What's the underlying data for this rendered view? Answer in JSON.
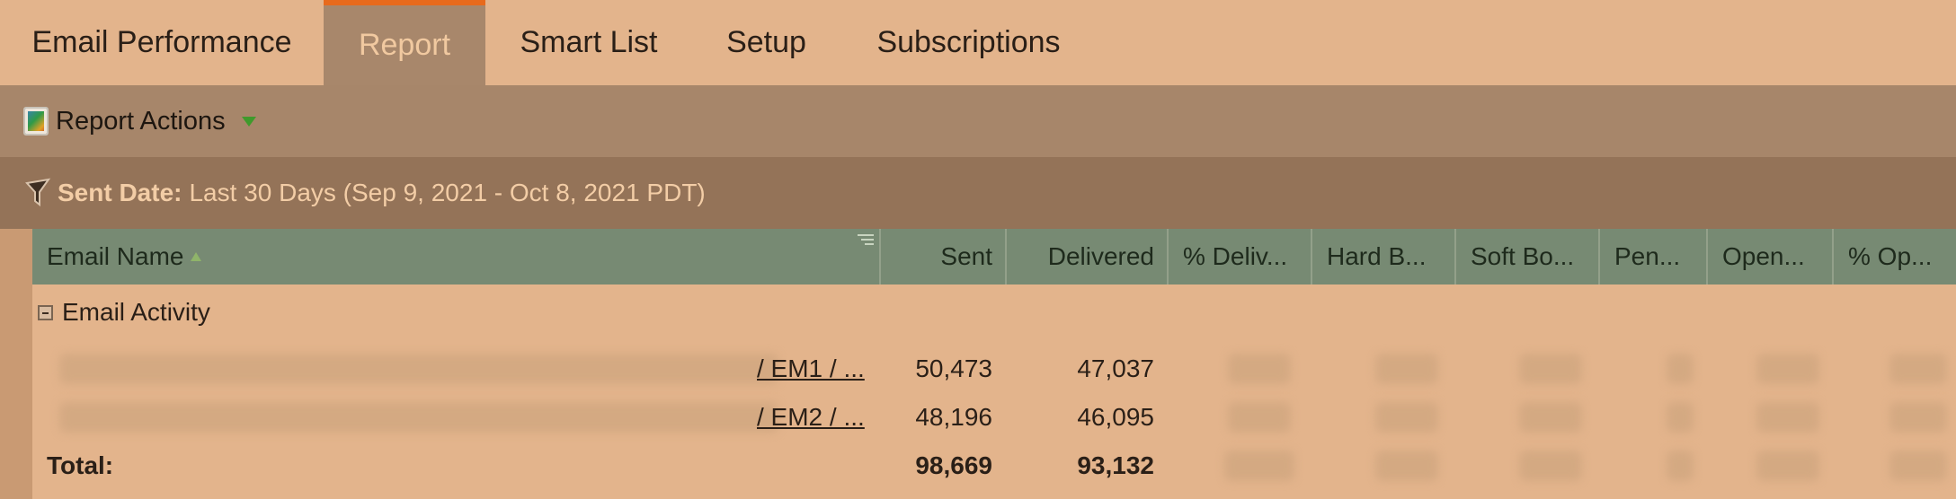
{
  "tabs": [
    {
      "label": "Email Performance",
      "active": false
    },
    {
      "label": "Report",
      "active": true
    },
    {
      "label": "Smart List",
      "active": false
    },
    {
      "label": "Setup",
      "active": false
    },
    {
      "label": "Subscriptions",
      "active": false
    }
  ],
  "actions": {
    "label": "Report Actions",
    "icon": "report-icon",
    "caret": "dropdown-caret-icon"
  },
  "filter": {
    "key": "Sent Date:",
    "value": "Last 30 Days (Sep 9, 2021 - Oct 8, 2021 PDT)",
    "icon": "funnel-icon"
  },
  "columns": [
    "Email Name",
    "Sent",
    "Delivered",
    "% Deliv...",
    "Hard B...",
    "Soft Bo...",
    "Pen...",
    "Open...",
    "% Op..."
  ],
  "group": {
    "label": "Email Activity"
  },
  "rows": [
    {
      "name_suffix": "/ EM1 / ...",
      "sent": "50,473",
      "delivered": "47,037"
    },
    {
      "name_suffix": "/ EM2 / ...",
      "sent": "48,196",
      "delivered": "46,095"
    }
  ],
  "total": {
    "label": "Total:",
    "sent": "98,669",
    "delivered": "93,132"
  },
  "colors": {
    "accent": "#e86a1c",
    "header_bg": "#778a73",
    "page_bg": "#e3b48c"
  }
}
